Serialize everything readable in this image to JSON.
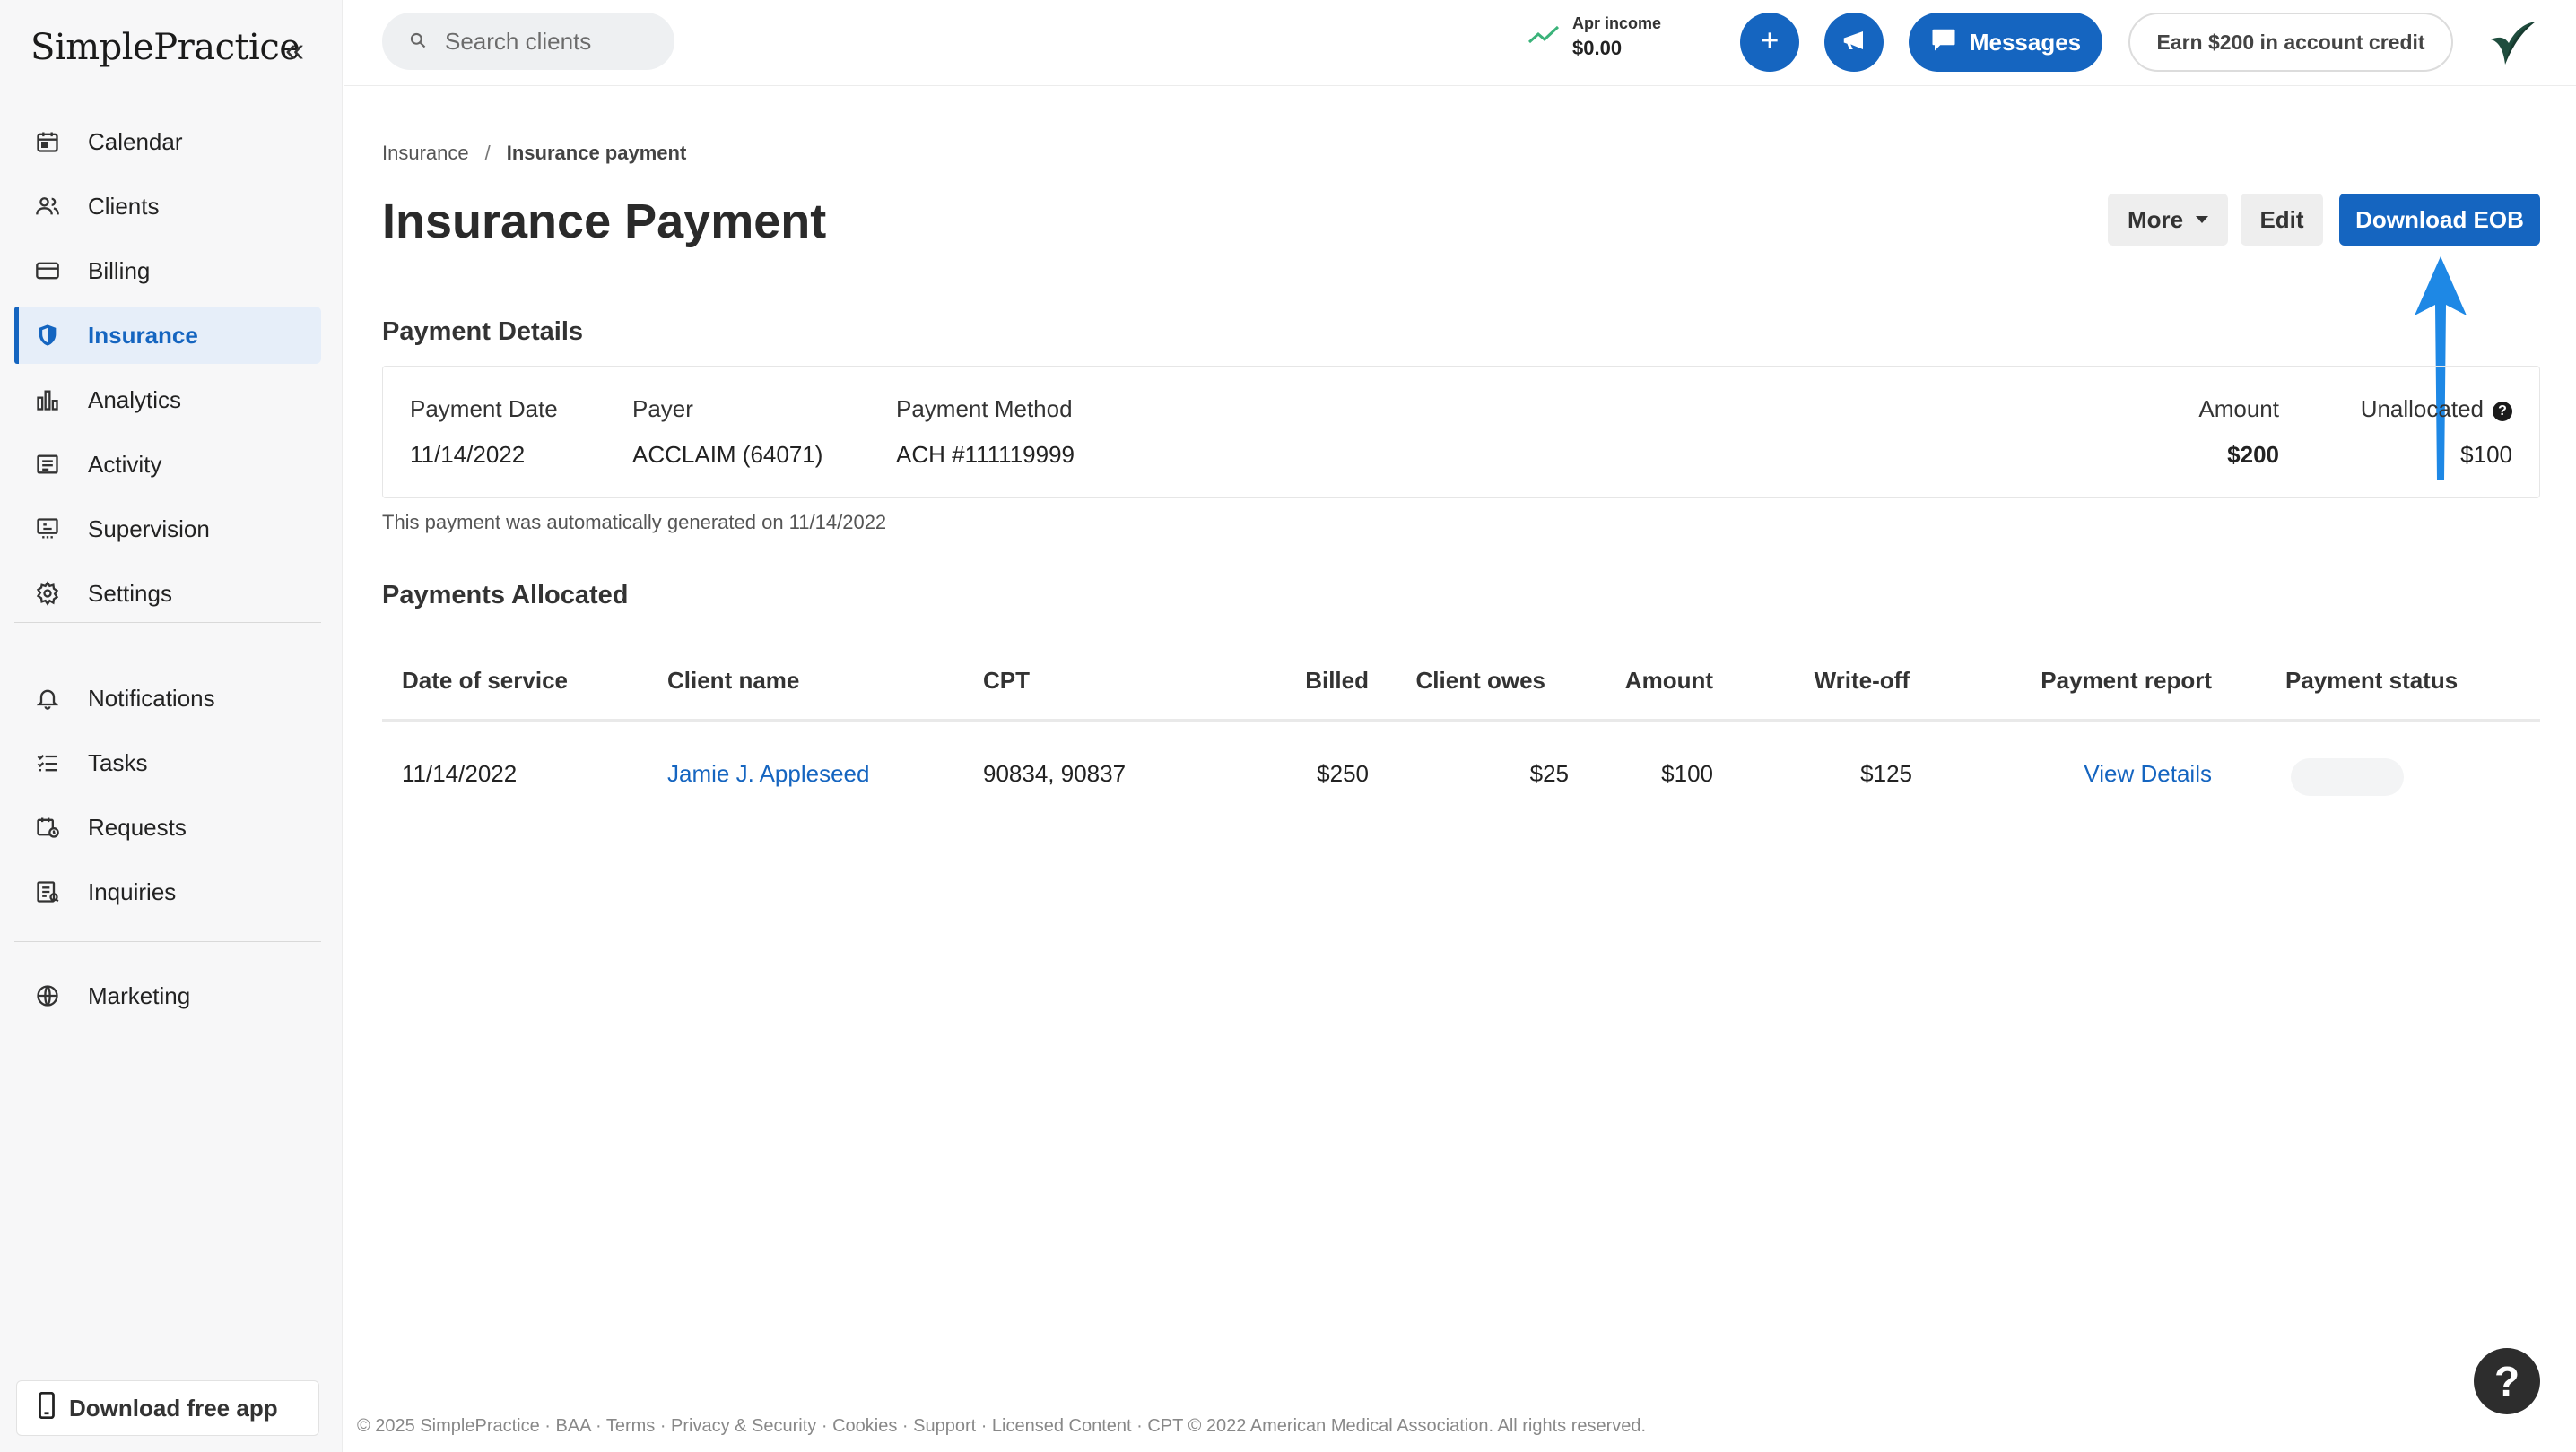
{
  "app": {
    "logo": "SimplePractice"
  },
  "sidebar": {
    "items": [
      {
        "label": "Calendar",
        "icon": "calendar-icon"
      },
      {
        "label": "Clients",
        "icon": "clients-icon"
      },
      {
        "label": "Billing",
        "icon": "billing-icon"
      },
      {
        "label": "Insurance",
        "icon": "shield-icon",
        "active": true
      },
      {
        "label": "Analytics",
        "icon": "analytics-icon"
      },
      {
        "label": "Activity",
        "icon": "activity-icon"
      },
      {
        "label": "Supervision",
        "icon": "supervision-icon"
      },
      {
        "label": "Settings",
        "icon": "gear-icon"
      }
    ],
    "items2": [
      {
        "label": "Notifications",
        "icon": "bell-icon"
      },
      {
        "label": "Tasks",
        "icon": "tasks-icon"
      },
      {
        "label": "Requests",
        "icon": "requests-icon"
      },
      {
        "label": "Inquiries",
        "icon": "inquiries-icon"
      }
    ],
    "items3": [
      {
        "label": "Marketing",
        "icon": "globe-icon"
      }
    ],
    "download_app": "Download free app"
  },
  "topbar": {
    "search_placeholder": "Search clients",
    "income_label": "Apr income",
    "income_value": "$0.00",
    "messages": "Messages",
    "earn": "Earn $200 in account credit"
  },
  "breadcrumb": {
    "parent": "Insurance",
    "separator": "/",
    "current": "Insurance payment"
  },
  "page": {
    "title": "Insurance Payment",
    "more": "More",
    "edit": "Edit",
    "download": "Download EOB"
  },
  "payment_details": {
    "heading": "Payment Details",
    "date_label": "Payment Date",
    "date": "11/14/2022",
    "payer_label": "Payer",
    "payer": "ACCLAIM (64071)",
    "method_label": "Payment Method",
    "method": "ACH #111119999",
    "amount_label": "Amount",
    "amount": "$200",
    "unallocated_label": "Unallocated",
    "unallocated": "$100",
    "note": "This payment was automatically generated on 11/14/2022"
  },
  "allocated": {
    "heading": "Payments Allocated",
    "columns": [
      "Date of service",
      "Client name",
      "CPT",
      "Billed",
      "Client owes",
      "Amount",
      "Write-off",
      "Payment report",
      "Payment status"
    ],
    "rows": [
      {
        "date": "11/14/2022",
        "client": "Jamie J. Appleseed",
        "cpt": "90834, 90837",
        "billed": "$250",
        "client_owes": "$25",
        "amount": "$100",
        "writeoff": "$125",
        "report": "View Details"
      }
    ]
  },
  "footer": "© 2025 SimplePractice · BAA · Terms · Privacy & Security · Cookies · Support · Licensed Content · CPT © 2022 American Medical Association. All rights reserved.",
  "help": "?",
  "colors": {
    "primary": "#1565c0",
    "arrow": "#1e88e5"
  }
}
